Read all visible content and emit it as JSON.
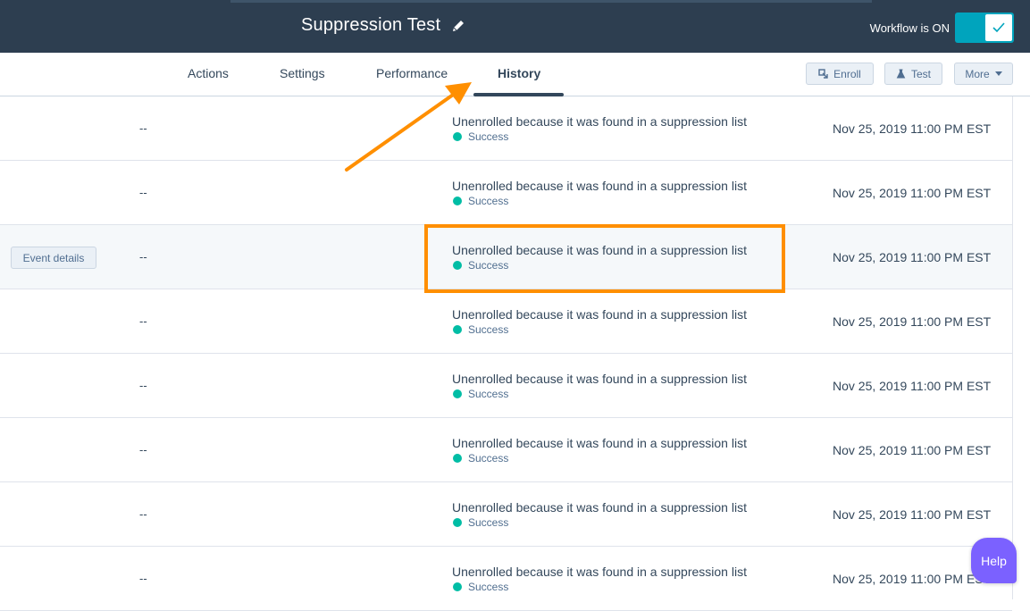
{
  "header": {
    "title": "Suppression Test",
    "workflow_status": "Workflow is ON"
  },
  "tabs": [
    {
      "label": "Actions"
    },
    {
      "label": "Settings"
    },
    {
      "label": "Performance"
    },
    {
      "label": "History",
      "active": true
    }
  ],
  "toolbar": {
    "enroll_label": "Enroll",
    "test_label": "Test",
    "more_label": "More"
  },
  "rows": [
    {
      "action": "",
      "dash": "--",
      "message": "Unenrolled because it was found in a suppression list",
      "status": "Success",
      "date": "Nov 25, 2019 11:00 PM EST"
    },
    {
      "action": "",
      "dash": "--",
      "message": "Unenrolled because it was found in a suppression list",
      "status": "Success",
      "date": "Nov 25, 2019 11:00 PM EST"
    },
    {
      "action": "Event details",
      "dash": "--",
      "message": "Unenrolled because it was found in a suppression list",
      "status": "Success",
      "date": "Nov 25, 2019 11:00 PM EST"
    },
    {
      "action": "",
      "dash": "--",
      "message": "Unenrolled because it was found in a suppression list",
      "status": "Success",
      "date": "Nov 25, 2019 11:00 PM EST"
    },
    {
      "action": "",
      "dash": "--",
      "message": "Unenrolled because it was found in a suppression list",
      "status": "Success",
      "date": "Nov 25, 2019 11:00 PM EST"
    },
    {
      "action": "",
      "dash": "--",
      "message": "Unenrolled because it was found in a suppression list",
      "status": "Success",
      "date": "Nov 25, 2019 11:00 PM EST"
    },
    {
      "action": "",
      "dash": "--",
      "message": "Unenrolled because it was found in a suppression list",
      "status": "Success",
      "date": "Nov 25, 2019 11:00 PM EST"
    },
    {
      "action": "",
      "dash": "--",
      "message": "Unenrolled because it was found in a suppression list",
      "status": "Success",
      "date": "Nov 25, 2019 11:00 PM EST"
    }
  ],
  "help_label": "Help",
  "colors": {
    "header_bg": "#2d3e50",
    "toggle_on": "#00a4bd",
    "success_dot": "#00bda5",
    "annotation": "#ff8f00",
    "help_bg": "#7b61ff"
  },
  "icons": {
    "edit": "pencil-icon",
    "toggle_check": "check-icon",
    "enroll": "enroll-icon",
    "test": "flask-icon",
    "more": "caret-down-icon"
  }
}
